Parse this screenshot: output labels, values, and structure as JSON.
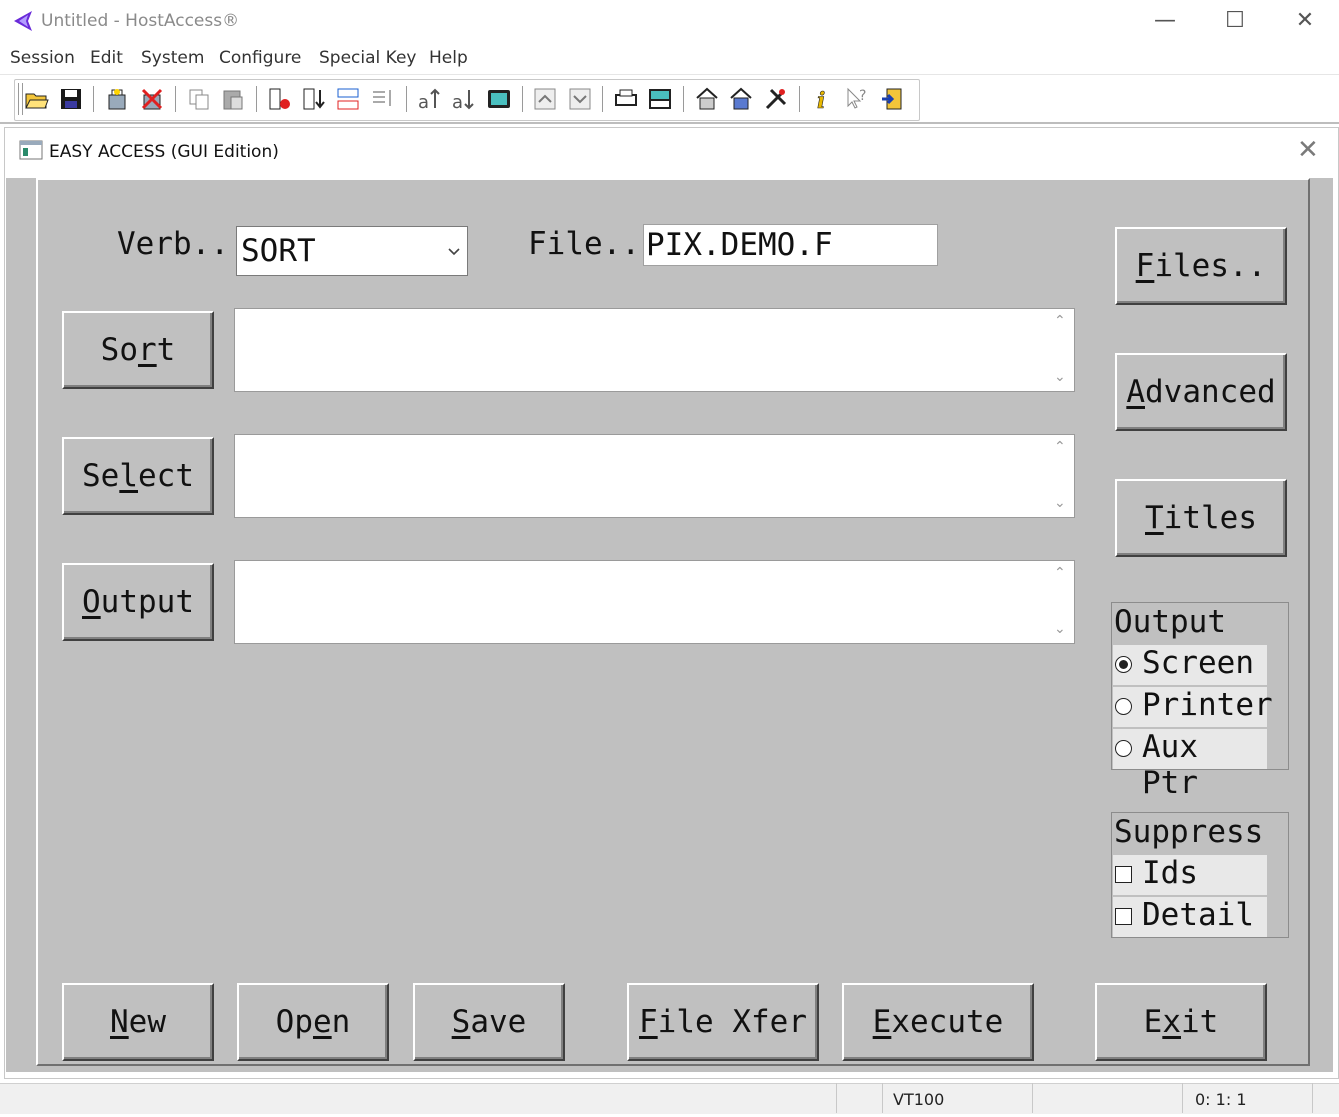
{
  "window": {
    "title": "Untitled - HostAccess®",
    "minimize": "—",
    "maximize": "☐",
    "close": "✕"
  },
  "menu": [
    "Session",
    "Edit",
    "System",
    "Configure",
    "Special Key",
    "Help"
  ],
  "toolbar": {
    "icons": [
      "open-folder-icon",
      "save-disk-icon",
      "connect-icon",
      "disconnect-icon",
      "copy-icon",
      "paste-icon",
      "record-icon",
      "sort-down-icon",
      "transfer-icon",
      "sort-list-icon",
      "upload-text-icon",
      "download-text-icon",
      "screen-icon",
      "page-up-icon",
      "page-down-icon",
      "print-icon",
      "print-screen-icon",
      "host-icon",
      "host-config-icon",
      "tools-icon",
      "info-icon",
      "context-help-icon",
      "exit-icon"
    ]
  },
  "inner_window": {
    "title": "EASY ACCESS (GUI Edition)",
    "close": "✕"
  },
  "form": {
    "verb_label": "Verb..",
    "verb_value": "SORT",
    "file_label": "File..",
    "file_value": "PIX.DEMO.F",
    "sort_btn": {
      "pre": "So",
      "key": "r",
      "post": "t"
    },
    "select_btn": {
      "pre": "Se",
      "key": "l",
      "post": "ect"
    },
    "output_btn": {
      "pre": "",
      "key": "O",
      "post": "utput"
    },
    "files_btn": {
      "pre": "",
      "key": "F",
      "post": "iles.."
    },
    "advanced_btn": {
      "pre": "",
      "key": "A",
      "post": "dvanced"
    },
    "titles_btn": {
      "pre": "",
      "key": "T",
      "post": "itles"
    },
    "output_group": {
      "title": "Output",
      "options": [
        "Screen",
        "Printer",
        "Aux Ptr"
      ],
      "selected": 0
    },
    "suppress_group": {
      "title": "Suppress",
      "options": [
        "Ids",
        "Detail"
      ]
    },
    "new_btn": {
      "pre": "",
      "key": "N",
      "post": "ew"
    },
    "open_btn": {
      "pre": "Op",
      "key": "e",
      "post": "n"
    },
    "save_btn": {
      "pre": "",
      "key": "S",
      "post": "ave"
    },
    "filexfer_btn": {
      "pre": "",
      "key": "F",
      "post": "ile Xfer"
    },
    "execute_btn": {
      "pre": "",
      "key": "E",
      "post": "xecute"
    },
    "exit_btn": {
      "pre": "E",
      "key": "x",
      "post": "it"
    }
  },
  "status": {
    "terminal": "VT100",
    "position": "0:  1:  1"
  },
  "colors": {
    "form_bg": "#c0c0c0",
    "accent_logo": "#6a2bd9"
  }
}
